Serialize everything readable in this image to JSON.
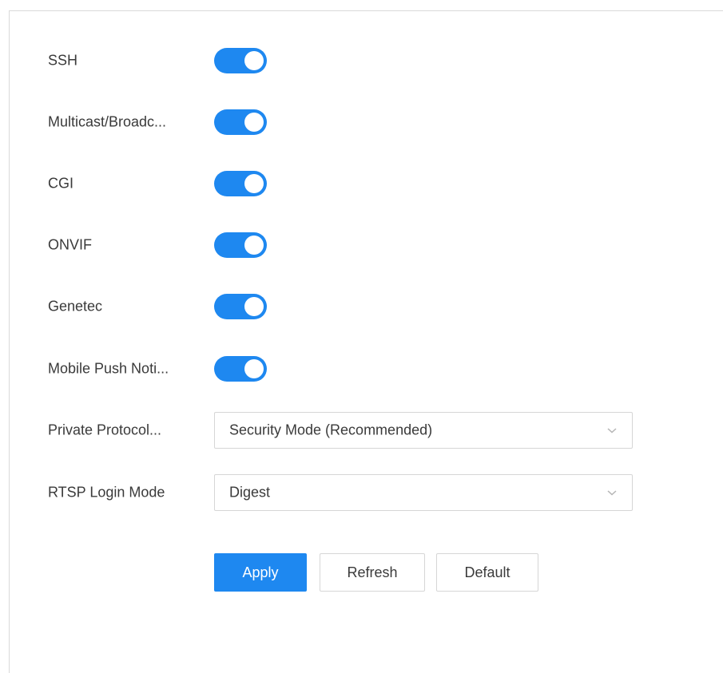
{
  "settings": {
    "toggles": [
      {
        "label": "SSH",
        "state": "on"
      },
      {
        "label": "Multicast/Broadc...",
        "state": "on"
      },
      {
        "label": "CGI",
        "state": "on"
      },
      {
        "label": "ONVIF",
        "state": "on"
      },
      {
        "label": "Genetec",
        "state": "on"
      },
      {
        "label": "Mobile Push Noti...",
        "state": "on"
      }
    ],
    "private_protocol": {
      "label": "Private Protocol...",
      "value": "Security Mode (Recommended)"
    },
    "rtsp_login_mode": {
      "label": "RTSP Login Mode",
      "value": "Digest"
    }
  },
  "actions": {
    "apply_label": "Apply",
    "refresh_label": "Refresh",
    "default_label": "Default"
  },
  "colors": {
    "accent": "#1e88f0",
    "text": "#3a3a3a",
    "border": "#d6d6d6"
  },
  "icons": {
    "dropdown": "chevron-down-icon"
  }
}
